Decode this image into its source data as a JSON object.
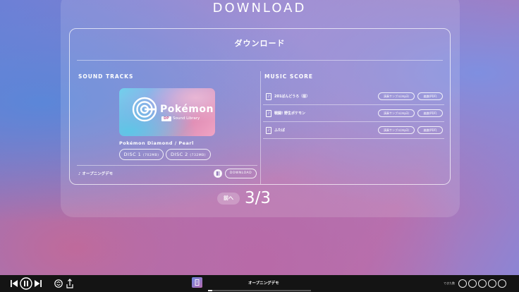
{
  "page": {
    "title": "DOWNLOAD"
  },
  "card": {
    "title": "ダウンロード"
  },
  "sound_tracks": {
    "heading": "SOUND TRACKS",
    "album": {
      "brand": "Pokémon",
      "badge": "DP",
      "subtitle": "Sound Library"
    },
    "game_title": "Pokémon Diamond / Pearl",
    "discs": [
      {
        "label": "DISC 1",
        "size": "(702MB)"
      },
      {
        "label": "DISC 2",
        "size": "(732MB)"
      }
    ],
    "now_playing": "♪ オープニングデモ",
    "download_label": "DOWNLOAD"
  },
  "music_score": {
    "heading": "MUSIC SCORE",
    "rows": [
      {
        "name": "201ばんどうろ（昼）",
        "audio_label": "演奏サンプル(mp3)",
        "score_label": "楽譜(PDF)"
      },
      {
        "name": "戦闘! 野生ポケモン",
        "audio_label": "演奏サンプル(mp3)",
        "score_label": "楽譜(PDF)"
      },
      {
        "name": "ふたば",
        "audio_label": "演奏サンプル(mp3)",
        "score_label": "楽譜(PDF)"
      }
    ]
  },
  "pager": {
    "prev_label": "前へ",
    "current": "3/3"
  },
  "player": {
    "track_title": "オープニングデモ",
    "progress": 0.04,
    "credits_label": "できた数",
    "credit_slots": 5,
    "icons": [
      "skip-back-icon",
      "pause-icon",
      "skip-forward-icon",
      "shuffle-icon",
      "share-icon",
      "score-icon"
    ]
  }
}
